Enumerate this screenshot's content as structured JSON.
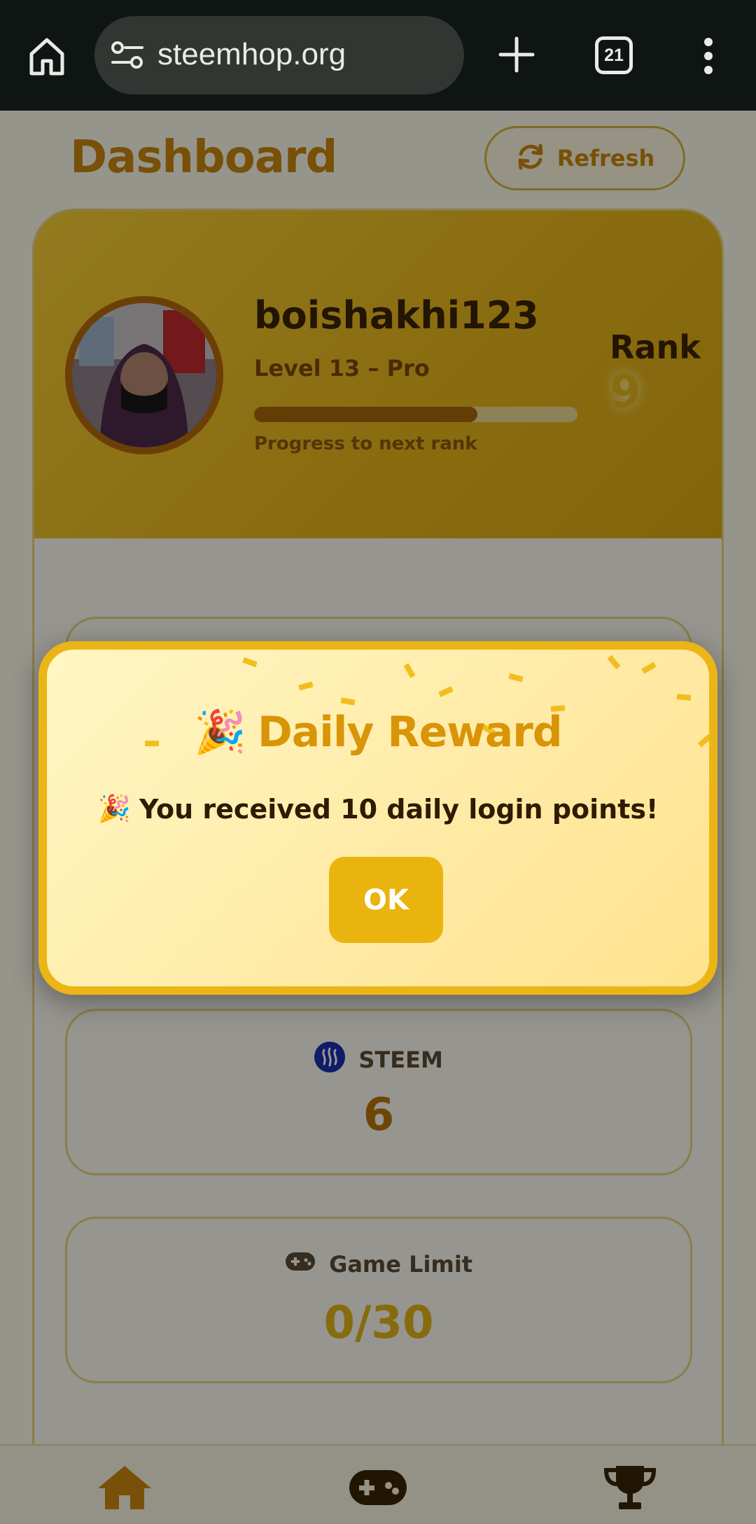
{
  "browser": {
    "url": "steemhop.org",
    "tab_count": "21",
    "icons": [
      "home-icon",
      "site-settings-icon",
      "new-tab-icon",
      "tabs-icon",
      "more-menu-icon"
    ]
  },
  "header": {
    "title": "Dashboard",
    "refresh_label": "Refresh"
  },
  "profile": {
    "username": "boishakhi123",
    "level": "Level 13 – Pro",
    "progress_fraction": 0.69,
    "progress_label": "Progress to next rank",
    "rank_label": "Rank",
    "rank_value": "9"
  },
  "stats": [
    {
      "label": "STEEM",
      "value": "6",
      "icon": "steem-icon",
      "color": "#b8730c"
    },
    {
      "label": "Game Limit",
      "value": "0/30",
      "icon": "gamepad-icon",
      "color": "#e0b21a"
    }
  ],
  "modal": {
    "title": "Daily Reward",
    "message": "You received 10 daily login points!",
    "ok_label": "OK",
    "title_emoji": "🎉",
    "message_emoji": "🎉"
  },
  "nav": {
    "items": [
      "home-icon",
      "gamepad-icon",
      "trophy-icon"
    ]
  },
  "colors": {
    "accent": "#ecb516",
    "title": "#c8860c",
    "profile_gradient_start": "#f4cc35",
    "profile_gradient_end": "#d9a812"
  }
}
